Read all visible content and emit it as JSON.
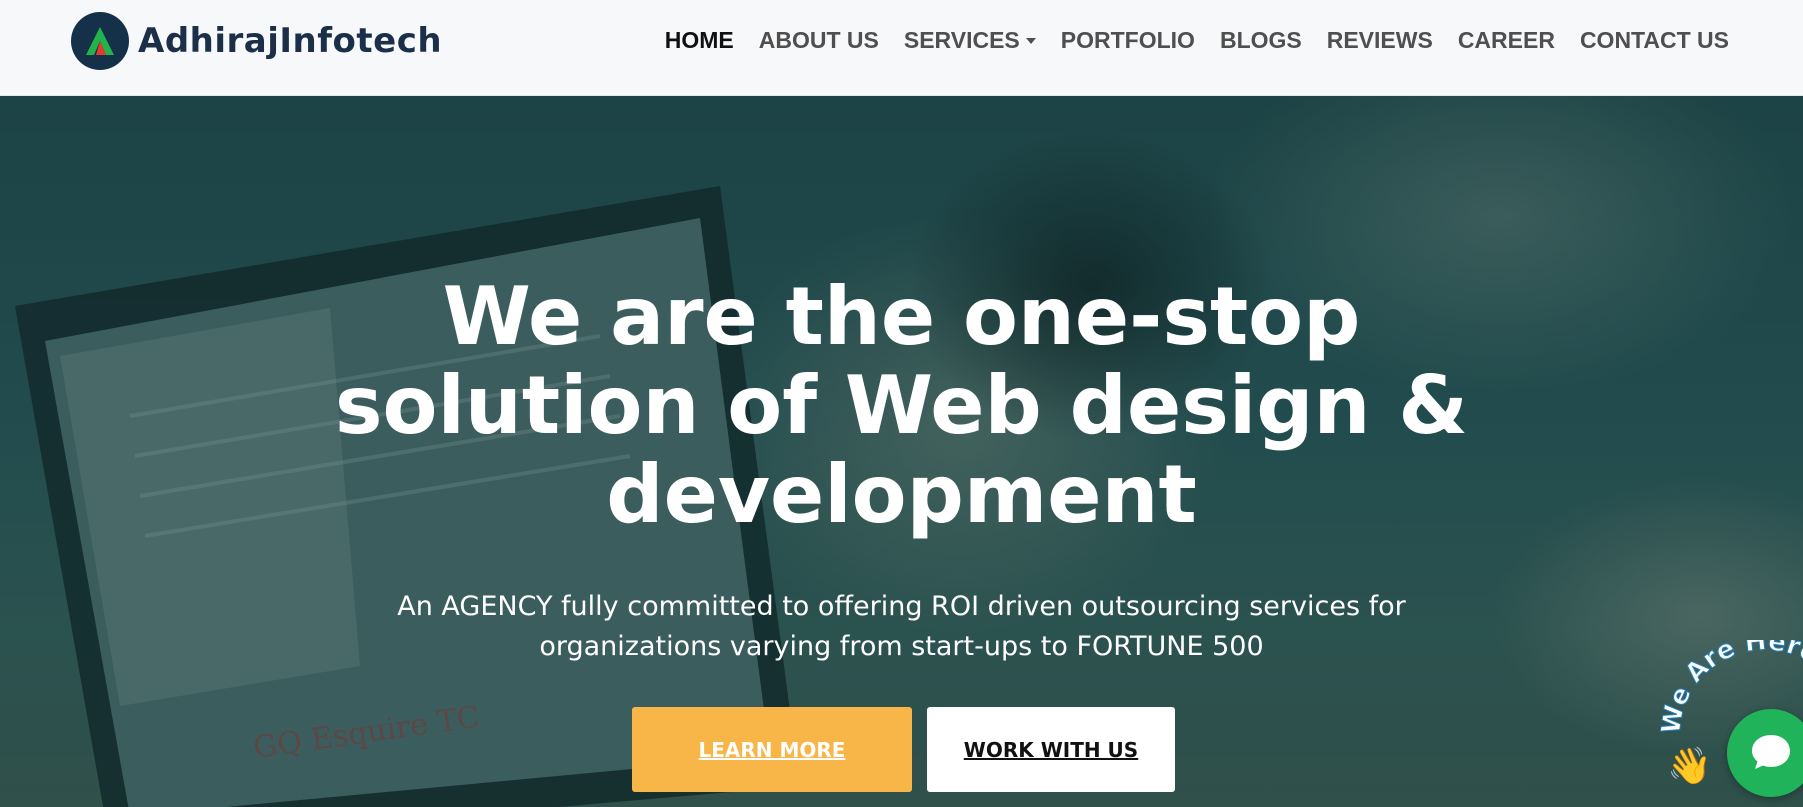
{
  "brand": {
    "name": "AdhirajInfotech",
    "logo_letter": "A"
  },
  "nav": {
    "items": [
      {
        "label": "HOME",
        "active": true
      },
      {
        "label": "ABOUT US"
      },
      {
        "label": "SERVICES",
        "has_dropdown": true
      },
      {
        "label": "PORTFOLIO"
      },
      {
        "label": "BLOGS"
      },
      {
        "label": "REVIEWS"
      },
      {
        "label": "CAREER"
      },
      {
        "label": "CONTACT US"
      }
    ]
  },
  "hero": {
    "title_line1": "We are the one-stop",
    "title_line2": "solution of Web design &",
    "title_line3": "development",
    "subtitle_line1": "An AGENCY fully committed to offering ROI driven outsourcing services for",
    "subtitle_line2": "organizations varying from start-ups to FORTUNE 500",
    "learn_more_label": "LEARN MORE",
    "work_with_us_label": "WORK WITH US"
  },
  "background_text": {
    "screen_logos": "GQ Esquire TC"
  },
  "chat_widget": {
    "arc_text": "We Are Here",
    "icon": "chat-bubble-icon",
    "wave_icon": "waving-hand-icon"
  },
  "colors": {
    "accent_orange": "#f8b548",
    "chat_green": "#21b35a",
    "nav_text": "#4f4f4f",
    "brand_dark": "#1b3048"
  }
}
